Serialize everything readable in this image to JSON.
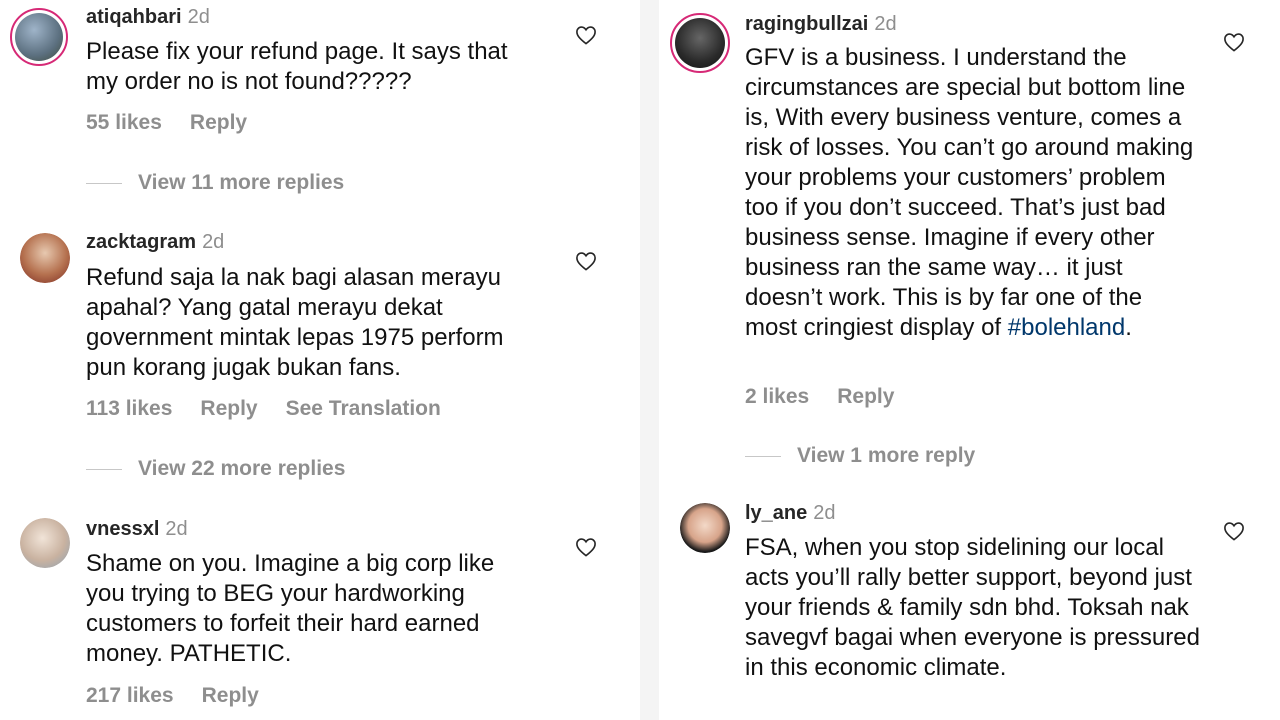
{
  "left": {
    "comments": [
      {
        "username": "atiqahbari",
        "time": "2d",
        "text": "Please fix your refund page. It says that my order no is not found?????",
        "likes": "55 likes",
        "reply": "Reply",
        "view_more": "View 11 more replies"
      },
      {
        "username": "zacktagram",
        "time": "2d",
        "text": "Refund saja la nak bagi alasan merayu apahal? Yang gatal merayu dekat government mintak lepas 1975 perform pun korang jugak bukan fans.",
        "likes": "113 likes",
        "reply": "Reply",
        "see_translation": "See Translation",
        "view_more": "View 22 more replies"
      },
      {
        "username": "vnessxl",
        "time": "2d",
        "text": "Shame on you. Imagine a big corp like you trying to BEG your hardworking customers to forfeit their hard earned money. PATHETIC.",
        "likes": "217 likes",
        "reply": "Reply"
      }
    ]
  },
  "right": {
    "comments": [
      {
        "username": "ragingbullzai",
        "time": "2d",
        "text": "GFV is a business. I understand the circumstances are special but bottom line is, With every business venture, comes a risk of losses. You can’t go around making your problems your customers’ problem too if you don’t succeed. That’s just bad business sense. Imagine if every other business ran the same way… it just doesn’t work. This is by far one of the most cringiest display of ",
        "hashtag": "#bolehland",
        "text_end": ".",
        "likes": "2 likes",
        "reply": "Reply",
        "view_more": "View 1 more reply"
      },
      {
        "username": "ly_ane",
        "time": "2d",
        "text": "FSA, when you stop sidelining our local acts you’ll rally better support, beyond just your friends & family sdn bhd. Toksah nak savegvf bagai when everyone is pressured in this economic climate."
      }
    ]
  },
  "colors": {
    "story_ring": "#d62976",
    "muted_text": "#8e8e8e",
    "hashtag": "#00376b"
  },
  "icons": {
    "like": "heart-outline-icon"
  }
}
